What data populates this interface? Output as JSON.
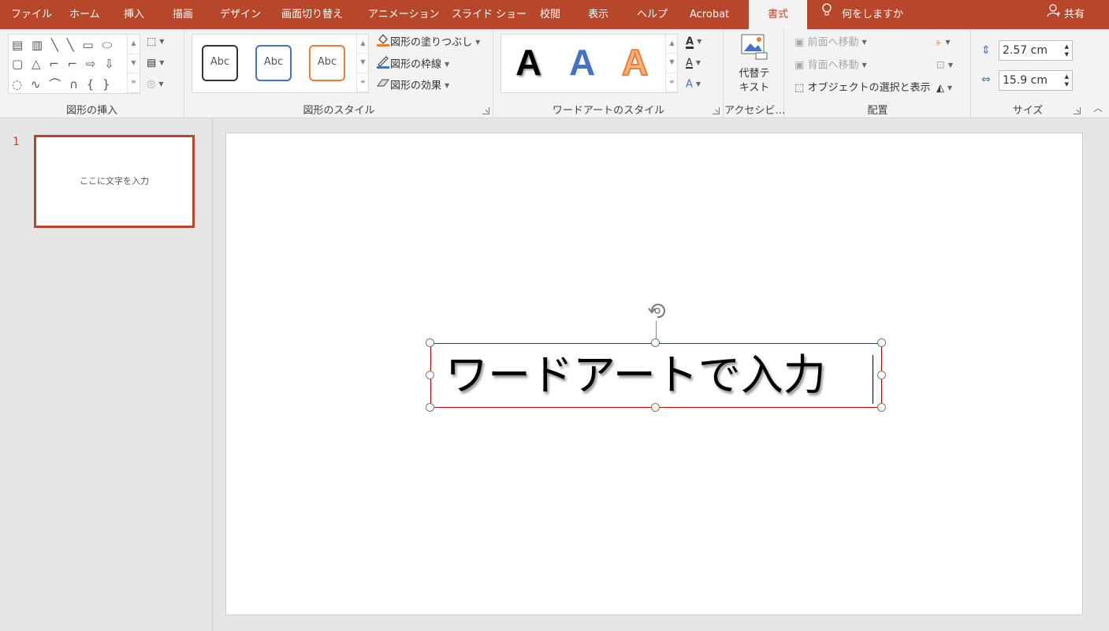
{
  "tabs": [
    {
      "label": "ファイル"
    },
    {
      "label": "ホーム"
    },
    {
      "label": "挿入"
    },
    {
      "label": "描画"
    },
    {
      "label": "デザイン"
    },
    {
      "label": "画面切り替え"
    },
    {
      "label": "アニメーション"
    },
    {
      "label": "スライド ショー"
    },
    {
      "label": "校閲"
    },
    {
      "label": "表示"
    },
    {
      "label": "ヘルプ"
    },
    {
      "label": "Acrobat"
    },
    {
      "label": "書式"
    }
  ],
  "active_tab": "書式",
  "tell_me": "何をしますか",
  "share": "共有",
  "ribbon": {
    "insert_shapes": {
      "label": "図形の挿入"
    },
    "shape_styles": {
      "label": "図形のスタイル",
      "samples": [
        "Abc",
        "Abc",
        "Abc"
      ],
      "fill": "図形の塗りつぶし",
      "outline": "図形の枠線",
      "effects": "図形の効果"
    },
    "wordart_styles": {
      "label": "ワードアートのスタイル",
      "samples": [
        "A",
        "A",
        "A"
      ]
    },
    "accessibility": {
      "label": "アクセシビ…",
      "alt_text_line1": "代替テ",
      "alt_text_line2": "キスト"
    },
    "arrange": {
      "label": "配置",
      "bring_forward": "前面へ移動",
      "send_backward": "背面へ移動",
      "selection_pane": "オブジェクトの選択と表示"
    },
    "size": {
      "label": "サイズ",
      "height": "2.57 cm",
      "width": "15.9 cm"
    }
  },
  "slides_pane": {
    "slide_number": "1",
    "thumbnail_text": "ここに文字を入力"
  },
  "slide": {
    "wordart_text": "ワードアートで入力"
  },
  "colors": {
    "accent": "#b7472a",
    "selection_border": "#c00000",
    "wordart_blue": "#4472c4",
    "wordart_orange": "#ed7d31"
  }
}
